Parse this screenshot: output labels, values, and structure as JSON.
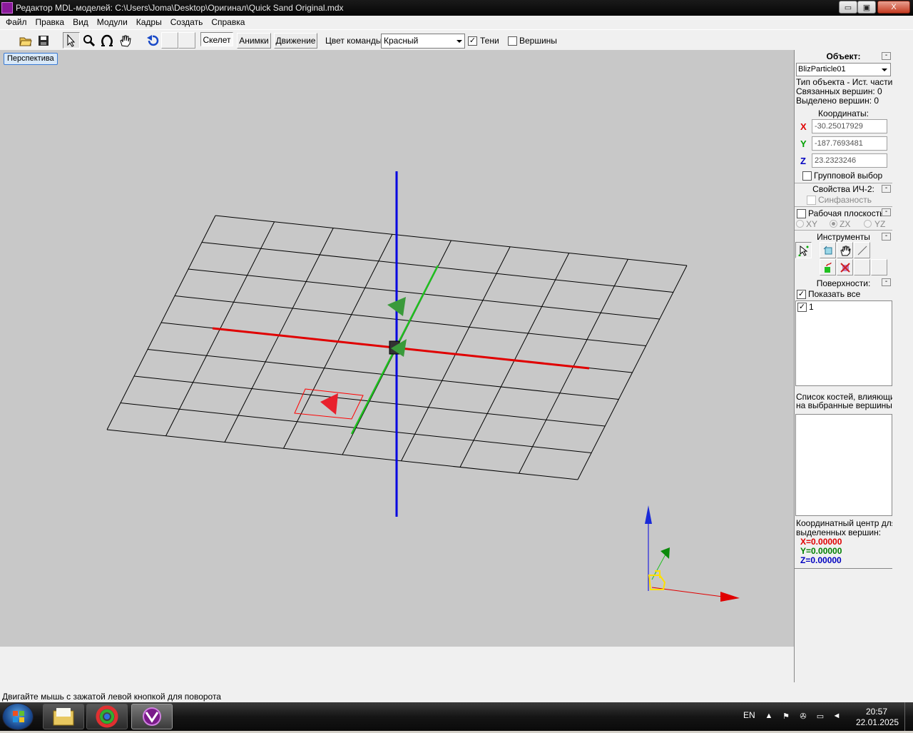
{
  "window": {
    "title": "Редактор MDL-моделей: C:\\Users\\Joma\\Desktop\\Оригинал\\Quick Sand Original.mdx",
    "min_label": "▭",
    "max_label": "▣",
    "close_label": "X"
  },
  "menu": [
    "Файл",
    "Правка",
    "Вид",
    "Модули",
    "Кадры",
    "Создать",
    "Справка"
  ],
  "toolbar": {
    "tabs": {
      "skeleton": "Скелет",
      "anim": "Анимки",
      "motion": "Движение"
    },
    "team_color_label": "Цвет команды:",
    "team_color_value": "Красный",
    "shadows_label": "Тени",
    "shadows_checked": true,
    "vertices_label": "Вершины",
    "vertices_checked": false
  },
  "viewport": {
    "perspective_label": "Перспектива",
    "background": "#c8c8c8"
  },
  "panel": {
    "object_header": "Объект:",
    "object_name": "BlizParticle01",
    "object_type": "Тип объекта - Ист. частиц",
    "linked_vertices": "Связанных вершин: 0",
    "selected_vertices": "Выделено вершин: 0",
    "coords_header": "Координаты:",
    "x_label": "X",
    "x_value": "-30.25017929",
    "y_label": "Y",
    "y_value": "-187.7693481",
    "z_label": "Z",
    "z_value": "23.2323246",
    "group_select": "Групповой выбор",
    "props_header": "Свойства ИЧ-2:",
    "sync": "Синфазность",
    "workplane": "Рабочая плоскость",
    "plane_xy": "XY",
    "plane_zx": "ZX",
    "plane_yz": "YZ",
    "tools_header": "Инструменты",
    "surfaces_header": "Поверхности:",
    "show_all": "Показать все",
    "surface_item": "1",
    "bones_caption_1": "Список костей, влияющих",
    "bones_caption_2": "на выбранные вершины:",
    "center_caption_1": "Координатный центр для",
    "center_caption_2": "выделенных вершин:",
    "cx": "X=0.00000",
    "cy": "Y=0.00000",
    "cz": "Z=0.00000",
    "collapse": "-"
  },
  "status": "Двигайте мышь с зажатой левой кнопкой для поворота",
  "taskbar": {
    "lang": "EN",
    "time": "20:57",
    "date": "22.01.2025"
  },
  "colors": {
    "x_axis": "#e00000",
    "y_axis": "#00a000",
    "z_axis": "#0000e0",
    "x_gizmo_fill": "#e8202c"
  }
}
